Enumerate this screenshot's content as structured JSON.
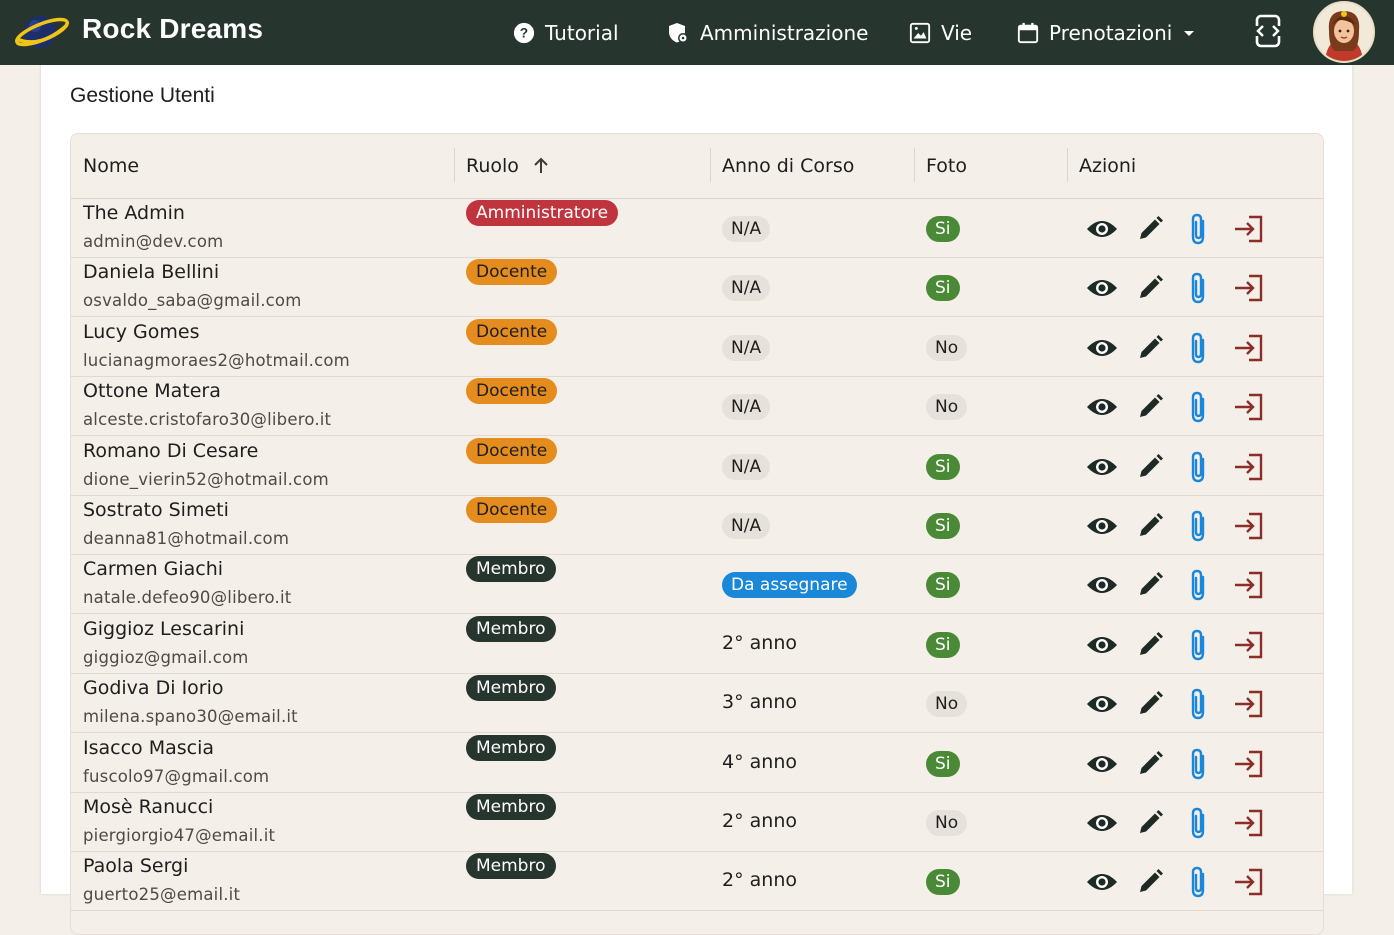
{
  "header": {
    "brand": "Rock Dreams",
    "nav": {
      "tutorial": "Tutorial",
      "admin": "Amministrazione",
      "vie": "Vie",
      "prenotazioni": "Prenotazioni"
    },
    "colors": {
      "bar": "#26362f",
      "text": "#ffffff"
    }
  },
  "page": {
    "title": "Gestione Utenti"
  },
  "table": {
    "columns": {
      "nome": "Nome",
      "ruolo": "Ruolo",
      "anno": "Anno di Corso",
      "foto": "Foto",
      "azioni": "Azioni"
    },
    "sort": {
      "column": "Ruolo",
      "direction": "ascending",
      "icon": "arrow-up-icon"
    },
    "rows": [
      {
        "name": "The Admin",
        "email": "admin@dev.com",
        "role": "Amministratore",
        "role_kind": "admin",
        "anno": "N/A",
        "anno_kind": "na",
        "foto": "Si",
        "foto_kind": "si"
      },
      {
        "name": "Daniela Bellini",
        "email": "osvaldo_saba@gmail.com",
        "role": "Docente",
        "role_kind": "docente",
        "anno": "N/A",
        "anno_kind": "na",
        "foto": "Si",
        "foto_kind": "si"
      },
      {
        "name": "Lucy Gomes",
        "email": "lucianagmoraes2@hotmail.com",
        "role": "Docente",
        "role_kind": "docente",
        "anno": "N/A",
        "anno_kind": "na",
        "foto": "No",
        "foto_kind": "no"
      },
      {
        "name": "Ottone Matera",
        "email": "alceste.cristofaro30@libero.it",
        "role": "Docente",
        "role_kind": "docente",
        "anno": "N/A",
        "anno_kind": "na",
        "foto": "No",
        "foto_kind": "no"
      },
      {
        "name": "Romano Di Cesare",
        "email": "dione_vierin52@hotmail.com",
        "role": "Docente",
        "role_kind": "docente",
        "anno": "N/A",
        "anno_kind": "na",
        "foto": "Si",
        "foto_kind": "si"
      },
      {
        "name": "Sostrato Simeti",
        "email": "deanna81@hotmail.com",
        "role": "Docente",
        "role_kind": "docente",
        "anno": "N/A",
        "anno_kind": "na",
        "foto": "Si",
        "foto_kind": "si"
      },
      {
        "name": "Carmen Giachi",
        "email": "natale.defeo90@libero.it",
        "role": "Membro",
        "role_kind": "membro",
        "anno": "Da assegnare",
        "anno_kind": "da",
        "foto": "Si",
        "foto_kind": "si"
      },
      {
        "name": "Giggioz Lescarini",
        "email": "giggioz@gmail.com",
        "role": "Membro",
        "role_kind": "membro",
        "anno": "2° anno",
        "anno_kind": "text",
        "foto": "Si",
        "foto_kind": "si"
      },
      {
        "name": "Godiva Di Iorio",
        "email": "milena.spano30@email.it",
        "role": "Membro",
        "role_kind": "membro",
        "anno": "3° anno",
        "anno_kind": "text",
        "foto": "No",
        "foto_kind": "no"
      },
      {
        "name": "Isacco Mascia",
        "email": "fuscolo97@gmail.com",
        "role": "Membro",
        "role_kind": "membro",
        "anno": "4° anno",
        "anno_kind": "text",
        "foto": "Si",
        "foto_kind": "si"
      },
      {
        "name": "Mosè Ranucci",
        "email": "piergiorgio47@email.it",
        "role": "Membro",
        "role_kind": "membro",
        "anno": "2° anno",
        "anno_kind": "text",
        "foto": "No",
        "foto_kind": "no"
      },
      {
        "name": "Paola Sergi",
        "email": "guerto25@email.it",
        "role": "Membro",
        "role_kind": "membro",
        "anno": "2° anno",
        "anno_kind": "text",
        "foto": "Si",
        "foto_kind": "si"
      }
    ],
    "row_actions": [
      "eye-icon",
      "pencil-icon",
      "paperclip-icon",
      "login-icon"
    ]
  },
  "colors": {
    "admin_chip": "#c0343e",
    "docente_chip": "#e58c1e",
    "membro_chip": "#26362f",
    "si_chip": "#4a8a36",
    "da_assegnare_chip": "#1a87d9",
    "attach_icon": "#1a87d9",
    "login_icon": "#8a2f28"
  }
}
